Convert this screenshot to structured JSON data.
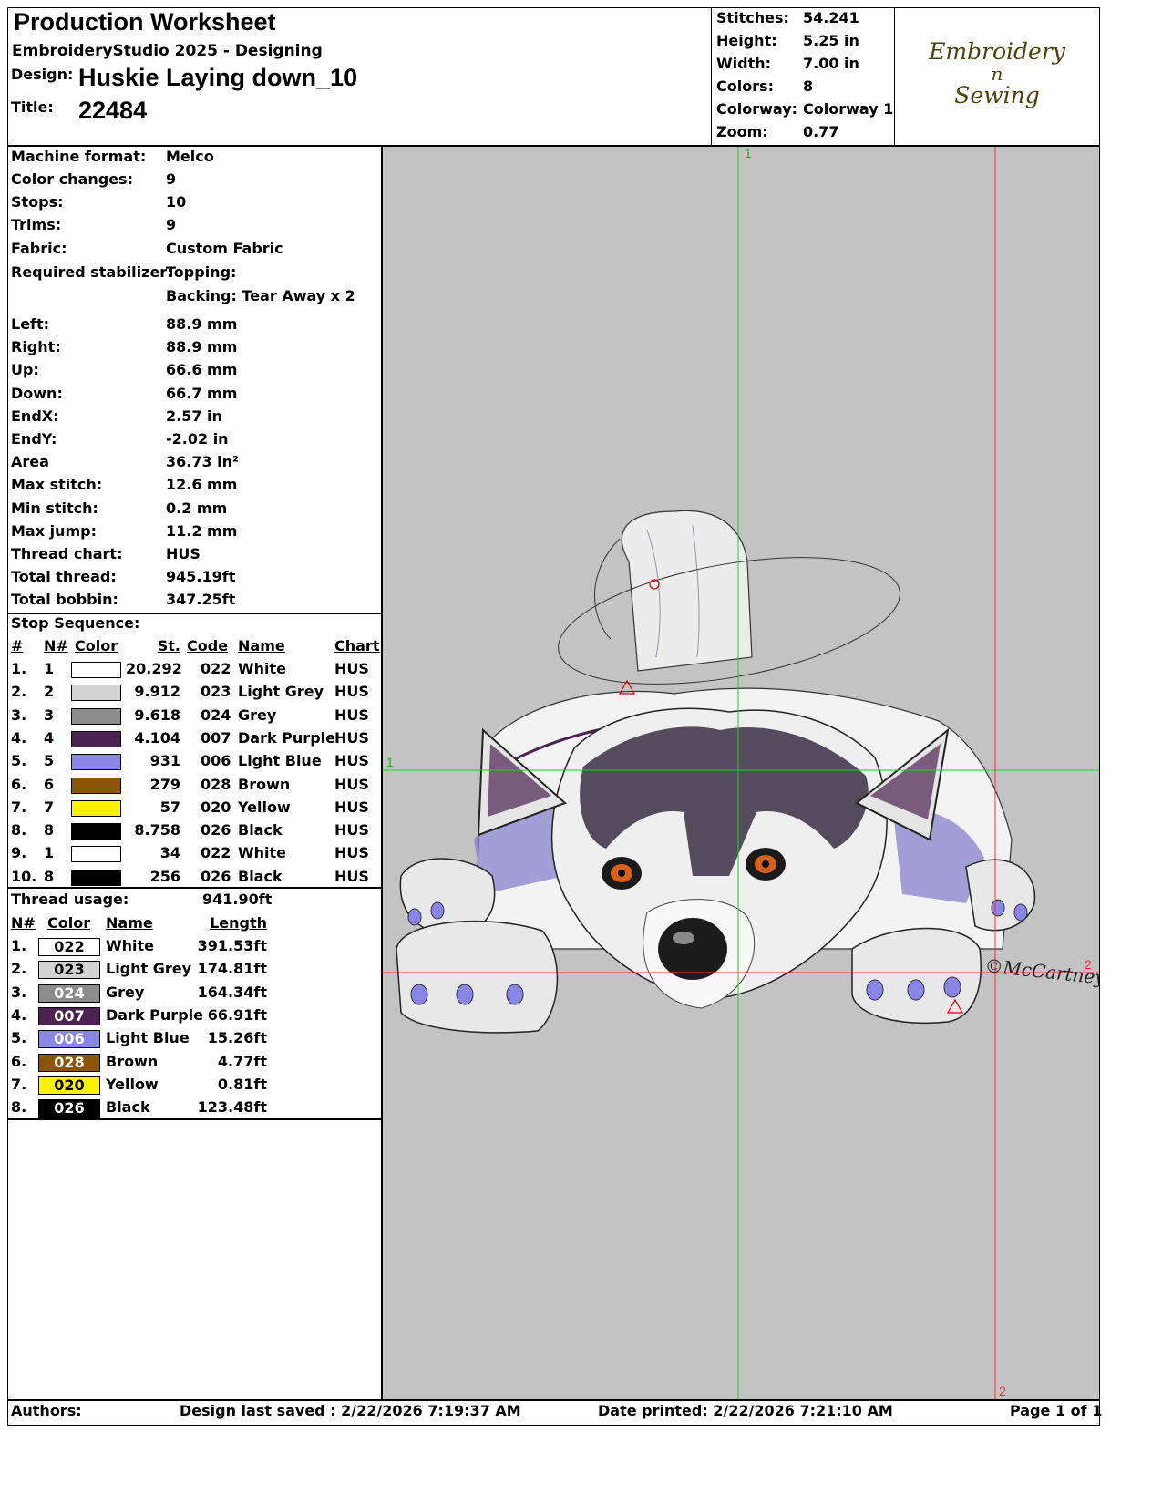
{
  "header": {
    "title": "Production Worksheet",
    "software": "EmbroideryStudio 2025 - Designing",
    "design_label": "Design:",
    "design_value": "Huskie Laying down_10",
    "title_label": "Title:",
    "title_value": "22484"
  },
  "stats": [
    {
      "label": "Stitches:",
      "value": "54.241"
    },
    {
      "label": "Height:",
      "value": "5.25 in"
    },
    {
      "label": "Width:",
      "value": "7.00 in"
    },
    {
      "label": "Colors:",
      "value": "8"
    },
    {
      "label": "Colorway:",
      "value": "Colorway 1"
    },
    {
      "label": "Zoom:",
      "value": "0.77"
    }
  ],
  "logo": {
    "line1": "Embroidery",
    "line2": "n",
    "line3": "Sewing"
  },
  "machine_info": [
    {
      "label": "Machine format:",
      "value": "Melco"
    },
    {
      "label": "Color changes:",
      "value": "9"
    },
    {
      "label": "Stops:",
      "value": "10"
    },
    {
      "label": "Trims:",
      "value": "9"
    },
    {
      "label": "Fabric:",
      "value": "Custom Fabric"
    },
    {
      "label": "Required stabilizer:",
      "value": "Topping:"
    },
    {
      "label": "",
      "value": "Backing: Tear Away x 2"
    }
  ],
  "measures": [
    {
      "label": "Left:",
      "value": "88.9 mm"
    },
    {
      "label": "Right:",
      "value": "88.9 mm"
    },
    {
      "label": "Up:",
      "value": "66.6 mm"
    },
    {
      "label": "Down:",
      "value": "66.7 mm"
    },
    {
      "label": "EndX:",
      "value": "2.57 in"
    },
    {
      "label": "EndY:",
      "value": "-2.02 in"
    },
    {
      "label": "Area",
      "value": " 36.73 in²"
    },
    {
      "label": "Max stitch:",
      "value": "12.6 mm"
    },
    {
      "label": "Min stitch:",
      "value": "0.2 mm"
    },
    {
      "label": "Max jump:",
      "value": "11.2 mm"
    },
    {
      "label": "Thread chart:",
      "value": "HUS"
    },
    {
      "label": "Total thread:",
      "value": "945.19ft"
    },
    {
      "label": "Total bobbin:",
      "value": "347.25ft"
    }
  ],
  "stop_sequence": {
    "title": "Stop Sequence:",
    "headers": [
      "#",
      "N#",
      "Color",
      "St.",
      "Code",
      "Name",
      "Chart"
    ],
    "rows": [
      {
        "idx": "1.",
        "n": "1",
        "color": "#ffffff",
        "st": "20.292",
        "code": "022",
        "name": "White",
        "chart": "HUS"
      },
      {
        "idx": "2.",
        "n": "2",
        "color": "#d3d3d3",
        "st": "9.912",
        "code": "023",
        "name": "Light Grey",
        "chart": "HUS"
      },
      {
        "idx": "3.",
        "n": "3",
        "color": "#8c8c8c",
        "st": "9.618",
        "code": "024",
        "name": "Grey",
        "chart": "HUS"
      },
      {
        "idx": "4.",
        "n": "4",
        "color": "#4b2250",
        "st": "4.104",
        "code": "007",
        "name": "Dark Purple",
        "chart": "HUS"
      },
      {
        "idx": "5.",
        "n": "5",
        "color": "#8a86e8",
        "st": "931",
        "code": "006",
        "name": "Light Blue",
        "chart": "HUS"
      },
      {
        "idx": "6.",
        "n": "6",
        "color": "#8b5406",
        "st": "279",
        "code": "028",
        "name": "Brown",
        "chart": "HUS"
      },
      {
        "idx": "7.",
        "n": "7",
        "color": "#fff200",
        "st": "57",
        "code": "020",
        "name": "Yellow",
        "chart": "HUS"
      },
      {
        "idx": "8.",
        "n": "8",
        "color": "#000000",
        "st": "8.758",
        "code": "026",
        "name": "Black",
        "chart": "HUS"
      },
      {
        "idx": "9.",
        "n": "1",
        "color": "#ffffff",
        "st": "34",
        "code": "022",
        "name": "White",
        "chart": "HUS"
      },
      {
        "idx": "10.",
        "n": "8",
        "color": "#000000",
        "st": "256",
        "code": "026",
        "name": "Black",
        "chart": "HUS"
      }
    ]
  },
  "thread_usage": {
    "title": "Thread usage:",
    "total": "941.90ft",
    "headers": [
      "N#",
      "Color",
      "Name",
      "Length"
    ],
    "rows": [
      {
        "idx": "1.",
        "code": "022",
        "color": "#ffffff",
        "text": "#000000",
        "name": "White",
        "length": "391.53ft"
      },
      {
        "idx": "2.",
        "code": "023",
        "color": "#d3d3d3",
        "text": "#000000",
        "name": "Light Grey",
        "length": "174.81ft"
      },
      {
        "idx": "3.",
        "code": "024",
        "color": "#8c8c8c",
        "text": "#ffffff",
        "name": "Grey",
        "length": "164.34ft"
      },
      {
        "idx": "4.",
        "code": "007",
        "color": "#4b2250",
        "text": "#ffffff",
        "name": "Dark Purple",
        "length": "66.91ft"
      },
      {
        "idx": "5.",
        "code": "006",
        "color": "#8a86e8",
        "text": "#ffffff",
        "name": "Light Blue",
        "length": "15.26ft"
      },
      {
        "idx": "6.",
        "code": "028",
        "color": "#8b5406",
        "text": "#ffffff",
        "name": "Brown",
        "length": "4.77ft"
      },
      {
        "idx": "7.",
        "code": "020",
        "color": "#fff200",
        "text": "#000000",
        "name": "Yellow",
        "length": "0.81ft"
      },
      {
        "idx": "8.",
        "code": "026",
        "color": "#000000",
        "text": "#ffffff",
        "name": "Black",
        "length": "123.48ft"
      }
    ]
  },
  "preview": {
    "bg_color": "#c3c3c3",
    "guide_v_green": "1",
    "guide_h_green": "1",
    "guide_red": "2",
    "signature": "©McCartney"
  },
  "footer": {
    "authors": "Authors:",
    "saved": "Design last saved : 2/22/2026 7:19:37 AM",
    "printed": "Date printed: 2/22/2026 7:21:10 AM",
    "page": "Page 1 of 1"
  }
}
